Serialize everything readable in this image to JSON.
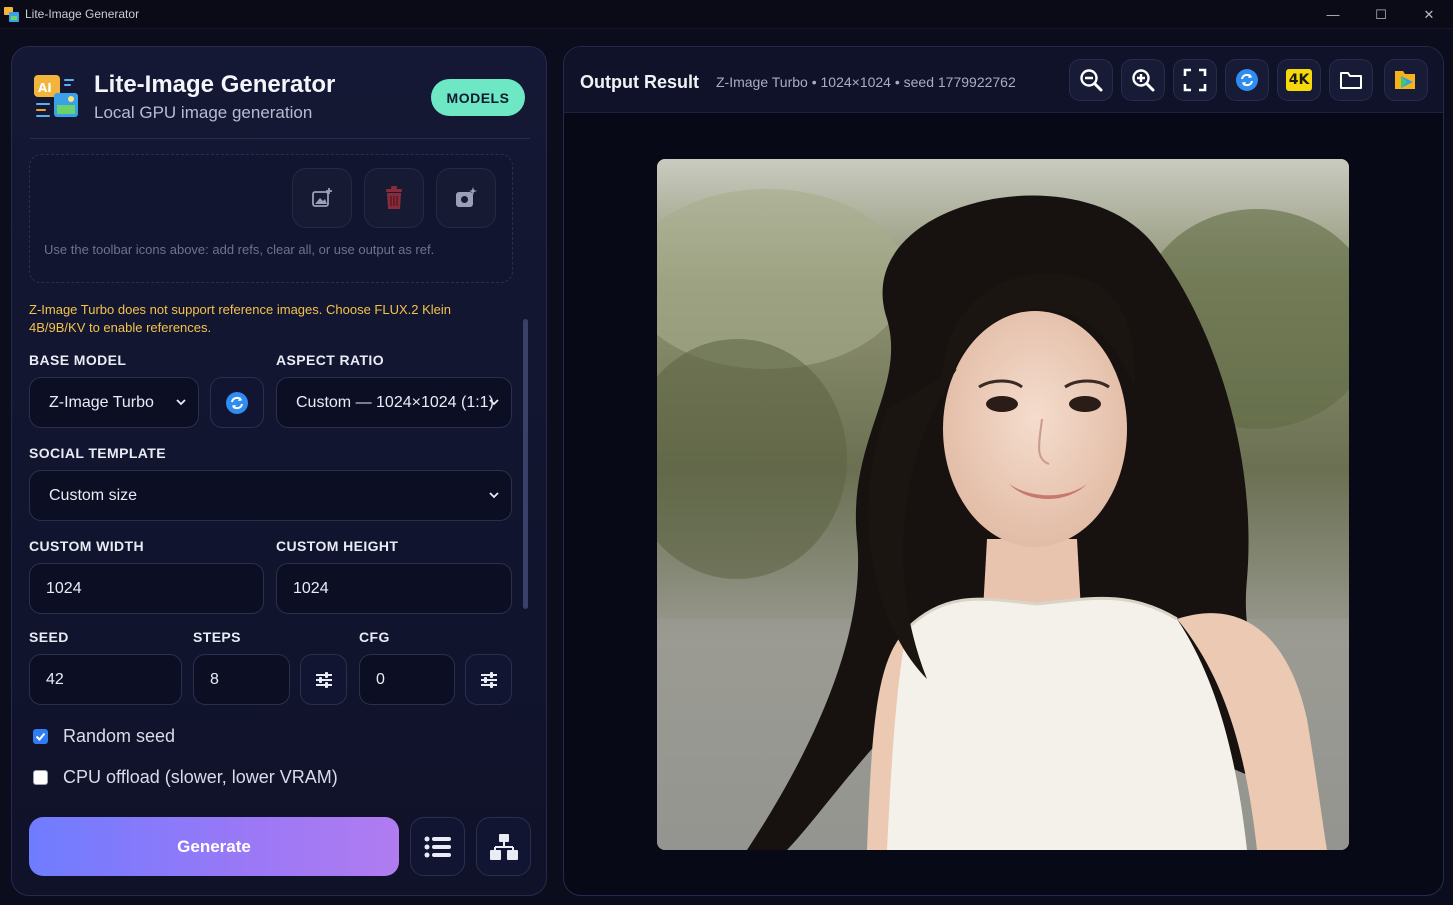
{
  "window": {
    "title": "Lite-Image Generator",
    "controls": {
      "minimize": "—",
      "maximize": "☐",
      "close": "✕"
    }
  },
  "brand": {
    "title": "Lite-Image Generator",
    "subtitle": "Local GPU image generation",
    "models_label": "MODELS"
  },
  "refs": {
    "hint": "Use the toolbar icons above: add refs, clear all, or use output as ref.",
    "tools": [
      "add-image-icon",
      "trash-icon",
      "use-output-icon"
    ]
  },
  "warning": "Z-Image Turbo does not support reference images. Choose FLUX.2 Klein 4B/9B/KV to enable references.",
  "form": {
    "base_model_label": "BASE MODEL",
    "base_model_value": "Z-Image Turbo",
    "aspect_label": "ASPECT RATIO",
    "aspect_value": "Custom — 1024×1024 (1:1)",
    "social_label": "SOCIAL TEMPLATE",
    "social_value": "Custom size",
    "width_label": "CUSTOM WIDTH",
    "width_value": "1024",
    "height_label": "CUSTOM HEIGHT",
    "height_value": "1024",
    "seed_label": "SEED",
    "seed_value": "42",
    "steps_label": "STEPS",
    "steps_value": "8",
    "cfg_label": "CFG",
    "cfg_value": "0",
    "random_seed_label": "Random seed",
    "random_seed_checked": true,
    "cpu_offload_label": "CPU offload (slower, lower VRAM)",
    "cpu_offload_checked": false,
    "generate_label": "Generate"
  },
  "output": {
    "title": "Output Result",
    "meta": "Z-Image Turbo • 1024×1024 • seed 1779922762",
    "toolbar": [
      "zoom-out-icon",
      "zoom-in-icon",
      "fullscreen-icon",
      "refresh-icon",
      "4k-upscale-icon",
      "folder-icon",
      "export-icon"
    ],
    "badge_4k": "4K"
  },
  "colors": {
    "accent_mint": "#6ee7c5",
    "accent_purple": "#8b7cf8",
    "warning": "#f4c24a",
    "refresh_blue": "#2f8cf0"
  }
}
